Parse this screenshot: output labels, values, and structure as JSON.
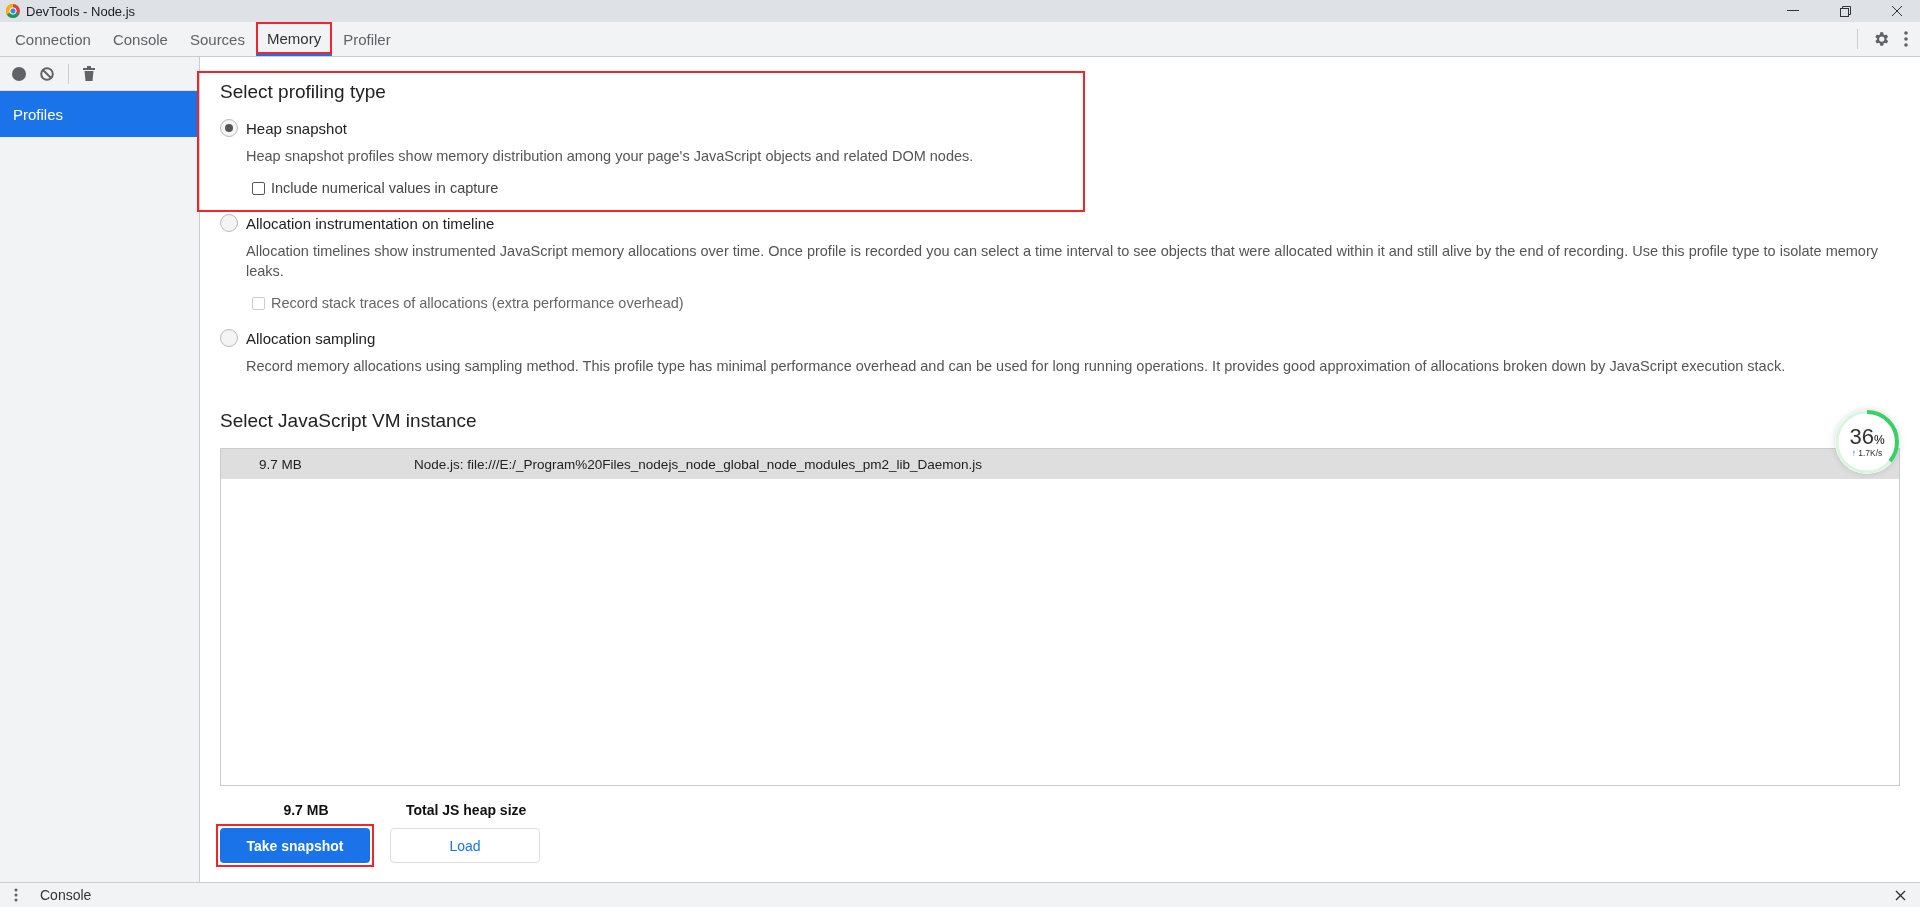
{
  "window": {
    "title": "DevTools - Node.js"
  },
  "tabs": [
    {
      "label": "Connection",
      "selected": false,
      "highlighted": false
    },
    {
      "label": "Console",
      "selected": false,
      "highlighted": false
    },
    {
      "label": "Sources",
      "selected": false,
      "highlighted": false
    },
    {
      "label": "Memory",
      "selected": true,
      "highlighted": true
    },
    {
      "label": "Profiler",
      "selected": false,
      "highlighted": false
    }
  ],
  "sidebar": {
    "items": [
      {
        "label": "Profiles",
        "selected": true
      }
    ]
  },
  "profiling": {
    "title": "Select profiling type",
    "options": [
      {
        "label": "Heap snapshot",
        "selected": true,
        "highlighted": true,
        "description": "Heap snapshot profiles show memory distribution among your page's JavaScript objects and related DOM nodes.",
        "checkbox": {
          "label": "Include numerical values in capture",
          "checked": false,
          "disabled": false
        }
      },
      {
        "label": "Allocation instrumentation on timeline",
        "selected": false,
        "highlighted": false,
        "description": "Allocation timelines show instrumented JavaScript memory allocations over time. Once profile is recorded you can select a time interval to see objects that were allocated within it and still alive by the end of recording. Use this profile type to isolate memory leaks.",
        "checkbox": {
          "label": "Record stack traces of allocations (extra performance overhead)",
          "checked": false,
          "disabled": true
        }
      },
      {
        "label": "Allocation sampling",
        "selected": false,
        "highlighted": false,
        "description": "Record memory allocations using sampling method. This profile type has minimal performance overhead and can be used for long running operations. It provides good approximation of allocations broken down by JavaScript execution stack."
      }
    ]
  },
  "vm": {
    "title": "Select JavaScript VM instance",
    "rows": [
      {
        "size": "9.7 MB",
        "name": "Node.js: file:///E:/_Program%20Files_nodejs_node_global_node_modules_pm2_lib_Daemon.js",
        "selected": true
      }
    ]
  },
  "heap": {
    "size": "9.7 MB",
    "label": "Total JS heap size"
  },
  "buttons": [
    {
      "label": "Take snapshot",
      "kind": "primary",
      "highlighted": true
    },
    {
      "label": "Load",
      "kind": "secondary",
      "highlighted": false
    }
  ],
  "meter": {
    "percent": "36",
    "unit": "%",
    "arrow": "↑",
    "speed": "1.7K/s",
    "level": 0.36
  },
  "drawer": {
    "label": "Console"
  }
}
